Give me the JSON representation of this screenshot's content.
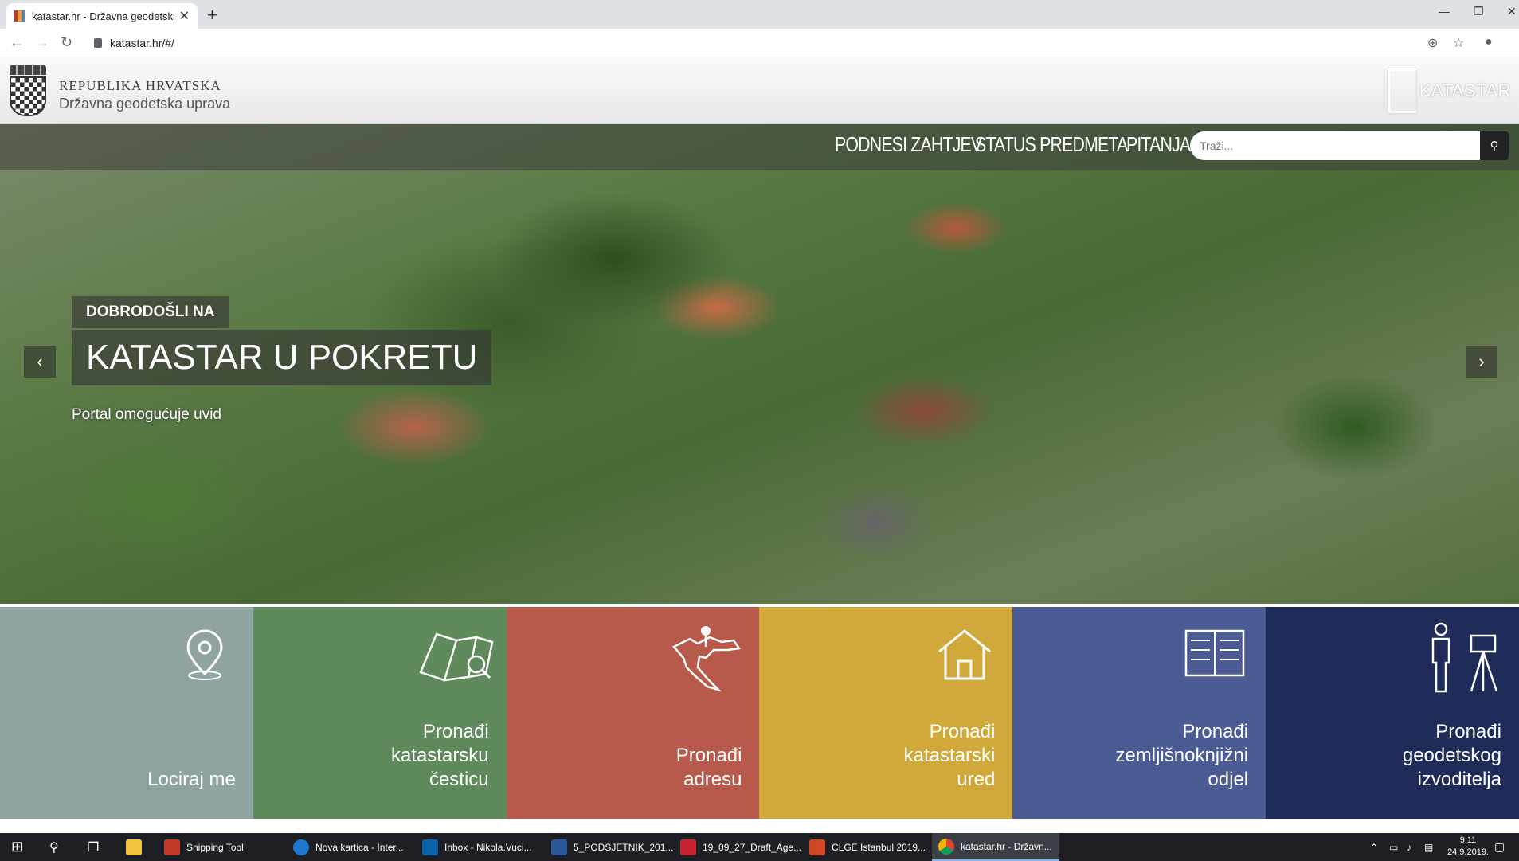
{
  "browser": {
    "tab_title": "katastar.hr - Državna geodetska u",
    "url": "katastar.hr/#/",
    "new_tab": "+"
  },
  "header": {
    "republic": "REPUBLIKA HRVATSKA",
    "agency": "Državna geodetska uprava",
    "logo_text": "KATASTAR"
  },
  "nav": {
    "links": [
      "PODNESI ZAHTJEV",
      "STATUS PREDMETA",
      "PITANJA"
    ],
    "search_placeholder": "Traži..."
  },
  "hero": {
    "welcome": "DOBRODOŠLI NA",
    "headline": "KATASTAR U POKRETU",
    "subtext": "Portal omogućuje uvid"
  },
  "tiles": [
    {
      "label": "Lociraj me",
      "color": "#8fa3a0",
      "icon": "location-pin-icon"
    },
    {
      "label": "Pronađi\nkatastarsku\nčesticu",
      "color": "#5f8a5c",
      "icon": "parcel-map-icon"
    },
    {
      "label": "Pronađi\nadresu",
      "color": "#b85a4b",
      "icon": "croatia-map-icon"
    },
    {
      "label": "Pronađi\nkatastarski\nured",
      "color": "#d1a83a",
      "icon": "house-icon"
    },
    {
      "label": "Pronađi\nzemljišnoknjižni\nodjel",
      "color": "#4b5c95",
      "icon": "land-book-icon"
    },
    {
      "label": "Pronađi\ngeodetskog\nizvoditelja",
      "color": "#1f2b58",
      "icon": "surveyor-icon"
    }
  ],
  "taskbar": {
    "items": [
      {
        "label": "Snipping Tool",
        "color": "#c0392b"
      },
      {
        "label": "Nova kartica - Inter...",
        "color": "#1f78d1"
      },
      {
        "label": "Inbox - Nikola.Vuci...",
        "color": "#0a64ad"
      },
      {
        "label": "5_PODSJETNIK_201...",
        "color": "#2b5797"
      },
      {
        "label": "19_09_27_Draft_Age...",
        "color": "#c82333"
      },
      {
        "label": "CLGE Istanbul 2019...",
        "color": "#d24726"
      },
      {
        "label": "katastar.hr - Državn...",
        "color": "#e0a52b"
      }
    ],
    "time": "9:11",
    "date": "24.9.2019."
  }
}
